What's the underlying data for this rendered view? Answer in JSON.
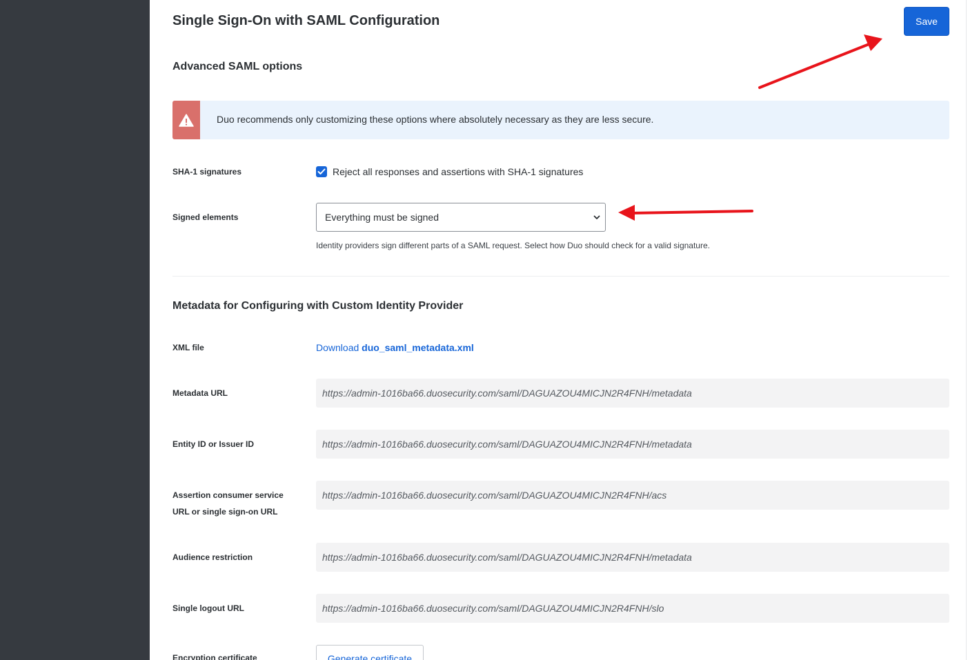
{
  "page": {
    "title": "Single Sign-On with SAML Configuration",
    "save_label": "Save"
  },
  "advanced": {
    "title": "Advanced SAML options",
    "alert_text": "Duo recommends only customizing these options where absolutely necessary as they are less secure.",
    "sha1": {
      "label": "SHA-1 signatures",
      "checkbox_label": "Reject all responses and assertions with SHA-1 signatures",
      "checked": true
    },
    "signed": {
      "label": "Signed elements",
      "selected": "Everything must be signed",
      "help": "Identity providers sign different parts of a SAML request. Select how Duo should check for a valid signature."
    }
  },
  "metadata": {
    "title": "Metadata for Configuring with Custom Identity Provider",
    "xml": {
      "label": "XML file",
      "link_prefix": "Download",
      "link_file": "duo_saml_metadata.xml"
    },
    "metadata_url": {
      "label": "Metadata URL",
      "value": "https://admin-1016ba66.duosecurity.com/saml/DAGUAZOU4MICJN2R4FNH/metadata"
    },
    "entity_id": {
      "label": "Entity ID or Issuer ID",
      "value": "https://admin-1016ba66.duosecurity.com/saml/DAGUAZOU4MICJN2R4FNH/metadata"
    },
    "acs": {
      "label_line1": "Assertion consumer service",
      "label_line2": "URL or single sign-on URL",
      "value": "https://admin-1016ba66.duosecurity.com/saml/DAGUAZOU4MICJN2R4FNH/acs"
    },
    "audience": {
      "label": "Audience restriction",
      "value": "https://admin-1016ba66.duosecurity.com/saml/DAGUAZOU4MICJN2R4FNH/metadata"
    },
    "slo": {
      "label": "Single logout URL",
      "value": "https://admin-1016ba66.duosecurity.com/saml/DAGUAZOU4MICJN2R4FNH/slo"
    },
    "encryption": {
      "label": "Encryption certificate",
      "button": "Generate certificate"
    }
  },
  "colors": {
    "primary": "#1665d8",
    "sidebar": "#363a40",
    "alert_bg": "#eaf3fd",
    "alert_icon_bg": "#d9706b",
    "annotation_arrow": "#e8141b"
  },
  "icons": [
    "warning-icon",
    "checkmark-icon",
    "chevron-down-icon"
  ]
}
